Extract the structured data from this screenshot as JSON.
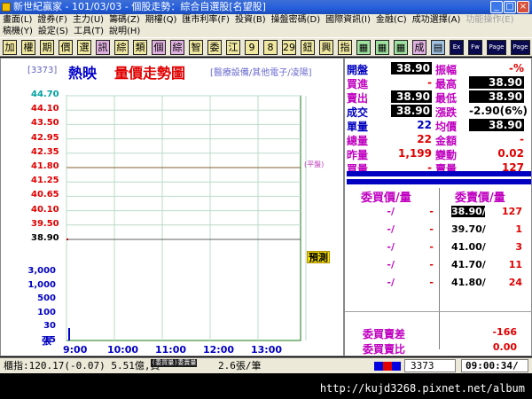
{
  "window": {
    "title": "新世紀贏家 - 101/03/03 - 個股走勢：綜合自選股[名望股]"
  },
  "menu": {
    "row1": [
      "畫面(L)",
      "證券(F)",
      "主力(U)",
      "籌碼(Z)",
      "期權(Q)",
      "匯市利率(F)",
      "投資(B)",
      "操盤密碼(D)",
      "國際資訊(I)",
      "金融(C)",
      "成功選擇(A)",
      "功能操作(E)"
    ],
    "row2": [
      "稿機(Y)",
      "設定(S)",
      "工具(T)",
      "說明(H)"
    ]
  },
  "toolbar": {
    "buttons": [
      "加",
      "權",
      "期",
      "價",
      "選",
      "訊",
      "綜",
      "類",
      "個",
      "綜",
      "智",
      "委",
      "江",
      "9",
      "8",
      "29",
      "鈕",
      "興",
      "指",
      "▦",
      "▦",
      "▦",
      "成",
      "▤",
      "Ex",
      "Fw",
      "Page",
      "Page"
    ]
  },
  "chart_header": {
    "code": "[3373]",
    "name": "熱映",
    "title": "量價走勢圖",
    "industry": "[醫療設備/其他電子/凌陽]"
  },
  "chart_data": {
    "type": "line",
    "price_ticks": [
      "44.70",
      "44.10",
      "43.50",
      "42.95",
      "42.35",
      "41.80",
      "41.25",
      "40.65",
      "40.10",
      "39.50",
      "38.90"
    ],
    "volume_ticks": [
      "3,000",
      "1,000",
      "500",
      "100",
      "30",
      "15"
    ],
    "volume_unit": "張",
    "x_ticks": [
      "9:00",
      "10:00",
      "11:00",
      "12:00",
      "13:00"
    ],
    "flat_label": "(平盤)",
    "ylim": [
      38.9,
      44.7
    ],
    "reference_price": 41.8,
    "price_points": [
      {
        "time": "9:00",
        "price": 38.9
      }
    ],
    "volume_points": [
      {
        "time": "9:00",
        "volume": 22
      }
    ]
  },
  "marker": {
    "label": "預測"
  },
  "quote": {
    "rows": [
      {
        "l1": "開盤",
        "v1": "38.90",
        "b1": true,
        "c1": "#0000c0",
        "l2": "振幅",
        "v2": "-%",
        "b2": false,
        "c2": "#e00000"
      },
      {
        "l1": "買進",
        "v1": "-",
        "b1": false,
        "c1": "#e00000",
        "l2": "最高",
        "v2": "38.90",
        "b2": true,
        "c2": "#e00000"
      },
      {
        "l1": "賣出",
        "v1": "38.90",
        "b1": true,
        "c1": "#e00000",
        "l2": "最低",
        "v2": "38.90",
        "b2": true,
        "c2": "#e00000"
      },
      {
        "l1": "成交",
        "v1": "38.90",
        "b1": true,
        "c1": "#0000c0",
        "l2": "漲跌",
        "v2": "-2.90(6%)",
        "b2": false,
        "c2": "#000000"
      },
      {
        "l1": "單量",
        "v1": "22",
        "b1": false,
        "c1": "#0000c0",
        "l2": "均價",
        "v2": "38.90",
        "b2": true,
        "c2": "#e00000"
      },
      {
        "l1": "總量",
        "v1": "22",
        "b1": false,
        "c1": "#e00000",
        "l2": "金額",
        "v2": "-",
        "b2": false,
        "c2": "#e00000"
      },
      {
        "l1": "昨量",
        "v1": "1,199",
        "b1": false,
        "c1": "#e00000",
        "l2": "變動",
        "v2": "0.02",
        "b2": false,
        "c2": "#e00000"
      },
      {
        "l1": "買量",
        "v1": "-",
        "b1": false,
        "c1": "#e00000",
        "l2": "賣量",
        "v2": "127",
        "b2": false,
        "c2": "#e00000"
      }
    ]
  },
  "orderbook": {
    "bid_header": "委買價/量",
    "ask_header": "委賣價/量",
    "rows": [
      {
        "bp": "-/",
        "bq": "-",
        "ap": "38.90/",
        "aq": "127",
        "boxed": true
      },
      {
        "bp": "-/",
        "bq": "-",
        "ap": "39.70/",
        "aq": "1",
        "boxed": false
      },
      {
        "bp": "-/",
        "bq": "-",
        "ap": "41.00/",
        "aq": "3",
        "boxed": false
      },
      {
        "bp": "-/",
        "bq": "-",
        "ap": "41.70/",
        "aq": "11",
        "boxed": false
      },
      {
        "bp": "-/",
        "bq": "-",
        "ap": "41.80/",
        "aq": "24",
        "boxed": false
      }
    ],
    "diff_label": "委買賣差",
    "diff_value": "-166",
    "ratio_label": "委買賣比",
    "ratio_value": "0.00"
  },
  "status": {
    "index_text": "櫃指:120.17(-0.07) 5.51億,買",
    "overlay": "(委買量)委賣量",
    "tail": "2.6張/筆",
    "code": "3373",
    "time": "09:00:34/"
  },
  "footer": {
    "url": "http://kujd3268.pixnet.net/album"
  }
}
